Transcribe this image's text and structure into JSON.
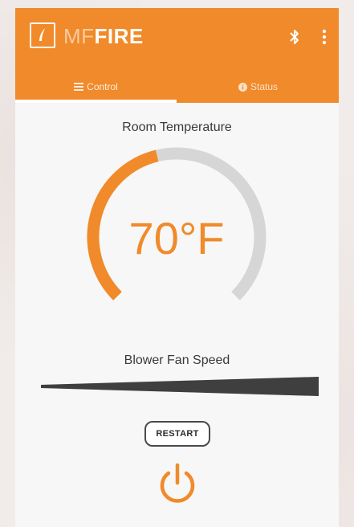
{
  "app": {
    "logo_light": "MF",
    "logo_bold": "FIRE"
  },
  "tabs": [
    {
      "label": "Control",
      "icon": "list-icon",
      "active": true
    },
    {
      "label": "Status",
      "icon": "info-circle-icon",
      "active": false
    }
  ],
  "room_temperature": {
    "label": "Room Temperature",
    "value": "70°F",
    "gauge_fraction": 0.45
  },
  "blower": {
    "label": "Blower Fan Speed",
    "level_fraction": 1.0
  },
  "restart_label": "RESTART",
  "colors": {
    "accent": "#f08a2a",
    "gauge_track": "#d6d6d6",
    "slider_fill": "#3f3f3f"
  }
}
